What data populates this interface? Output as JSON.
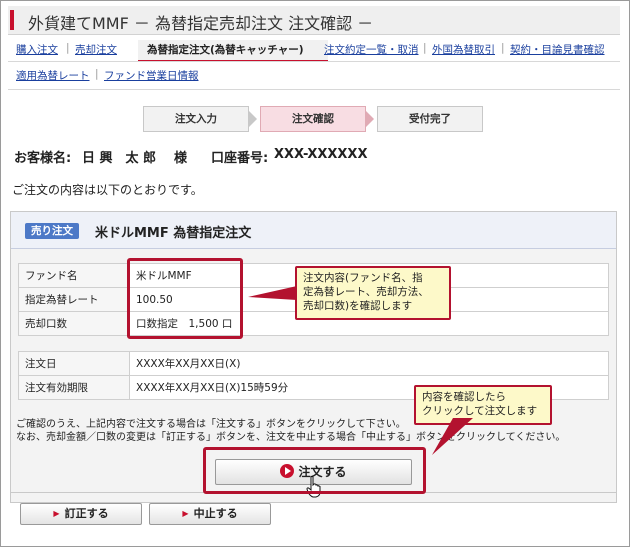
{
  "page": {
    "title": "外貨建てMMF － 為替指定売却注文 注文確認 －",
    "intro": "ご注文の内容は以下のとおりです。"
  },
  "nav": {
    "primary": [
      "購入注文",
      "売却注文",
      "為替指定注文(為替キャッチャー)",
      "注文約定一覧・取消",
      "外国為替取引",
      "契約・目論見書確認"
    ],
    "secondary": [
      "適用為替レート",
      "ファンド営業日情報"
    ]
  },
  "steps": [
    "注文入力",
    "注文確認",
    "受付完了"
  ],
  "customer": {
    "name_label": "お客様名:",
    "name": "日 興　太 郎",
    "honorific": "様",
    "account_label": "口座番号:",
    "account_number": "XXX-XXXXXX"
  },
  "order": {
    "badge": "売り注文",
    "title": "米ドルMMF 為替指定注文",
    "rows": [
      {
        "label": "ファンド名",
        "value": "米ドルMMF"
      },
      {
        "label": "指定為替レート",
        "value": "100.50"
      },
      {
        "label": "売却口数",
        "value": "口数指定　1,500 口"
      }
    ],
    "rows2": [
      {
        "label": "注文日",
        "value": "XXXX年XX月XX日(X)"
      },
      {
        "label": "注文有効期限",
        "value": "XXXX年XX月XX日(X)15時59分"
      }
    ]
  },
  "notes": {
    "line1": "ご確認のうえ、上記内容で注文する場合は「注文する」ボタンをクリックして下さい。",
    "line2": "なお、売却金額／口数の変更は「訂正する」ボタンを、注文を中止する場合「中止する」ボタンをクリックしてください。"
  },
  "buttons": {
    "submit": "注文する",
    "correct": "訂正する",
    "cancel": "中止する"
  },
  "annotations": {
    "callout1": [
      "注文内容(ファンド名、指",
      "定為替レート、売却方法、",
      "売却口数)を確認します"
    ],
    "callout2": [
      "内容を確認したら",
      "クリックして注文します"
    ]
  },
  "colors": {
    "accent": "#c8102e",
    "link": "#1a3f9e",
    "badge": "#4d79c7",
    "callout_bg": "#fdf9c9",
    "callout_border": "#b3122f"
  }
}
